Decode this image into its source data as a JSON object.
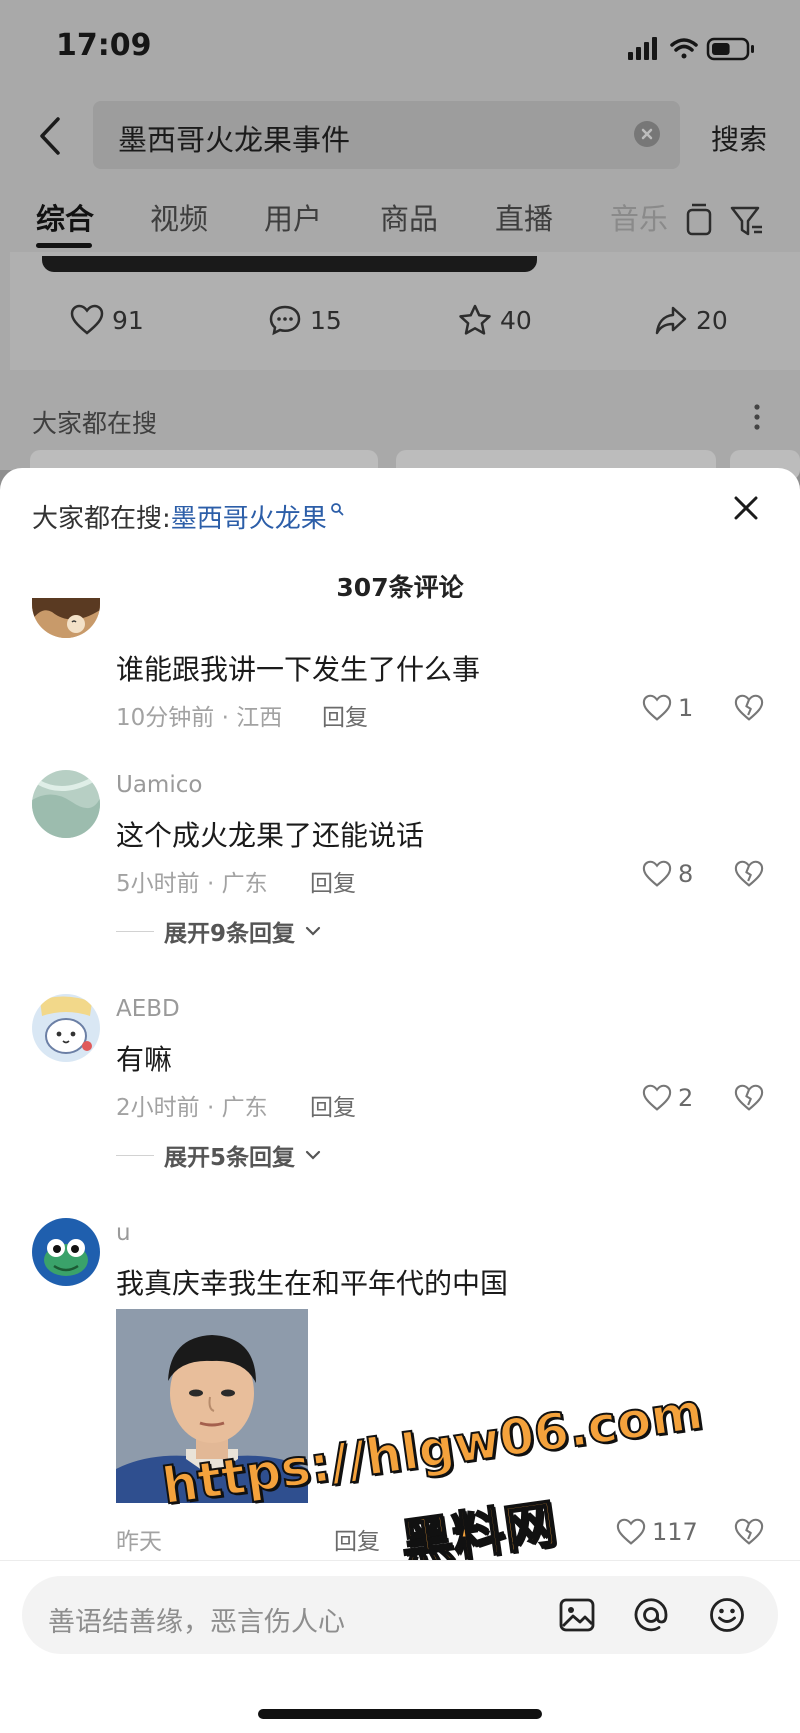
{
  "status_bar": {
    "time": "17:09",
    "battery_level": 0.55
  },
  "search": {
    "query": "墨西哥火龙果事件",
    "submit_label": "搜索"
  },
  "tabs": [
    {
      "label": "综合",
      "active": true
    },
    {
      "label": "视频",
      "active": false
    },
    {
      "label": "用户",
      "active": false
    },
    {
      "label": "商品",
      "active": false
    },
    {
      "label": "直播",
      "active": false
    },
    {
      "label": "音乐",
      "active": false
    }
  ],
  "post_stats": {
    "likes": "91",
    "comments": "15",
    "favorites": "40",
    "shares": "20"
  },
  "trending": {
    "title": "大家都在搜"
  },
  "comment_sheet": {
    "hot_search_prefix": "大家都在搜:",
    "hot_search_keyword": "墨西哥火龙果",
    "comment_count": "307条评论",
    "comments": [
      {
        "username": "",
        "text": "谁能跟我讲一下发生了什么事",
        "meta": "10分钟前 · 江西",
        "reply_label": "回复",
        "likes": "1",
        "expand": ""
      },
      {
        "username": "Uamico",
        "text": "这个成火龙果了还能说话",
        "meta": "5小时前 · 广东",
        "reply_label": "回复",
        "likes": "8",
        "expand": "展开9条回复"
      },
      {
        "username": "AEBD",
        "text": "有嘛",
        "meta": "2小时前 · 广东",
        "reply_label": "回复",
        "likes": "2",
        "expand": "展开5条回复"
      },
      {
        "username": "u",
        "text": "我真庆幸我生在和平年代的中国",
        "meta": "昨天",
        "reply_label": "回复",
        "likes": "117",
        "expand": ""
      }
    ]
  },
  "watermark": {
    "line1": "https://hlgw06.com",
    "line2": "黑料网"
  },
  "composer": {
    "placeholder": "善语结善缘，恶言伤人心"
  },
  "colors": {
    "link": "#2c5ea8",
    "watermark": "#f4a23c"
  }
}
